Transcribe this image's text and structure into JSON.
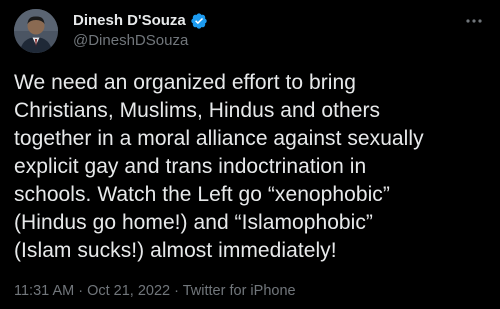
{
  "author": {
    "display_name": "Dinesh D'Souza",
    "handle": "@DineshDSouza",
    "verified_icon": "verified-badge-icon",
    "verified_color": "#1d9bf0"
  },
  "tweet": {
    "text": "We need an organized effort to bring\nChristians, Muslims, Hindus and others\ntogether in a moral alliance against sexually\nexplicit gay and trans indoctrination in\nschools. Watch the Left go “xenophobic”\n(Hindus go home!) and “Islamophobic”\n(Islam sucks!) almost immediately!"
  },
  "meta": {
    "time": "11:31 AM",
    "separator": " · ",
    "date": "Oct 21, 2022",
    "source": "Twitter for iPhone"
  },
  "icons": {
    "more": "more-options-icon"
  },
  "colors": {
    "background": "#000000",
    "primary_text": "#e7e9ea",
    "secondary_text": "#71767b"
  }
}
